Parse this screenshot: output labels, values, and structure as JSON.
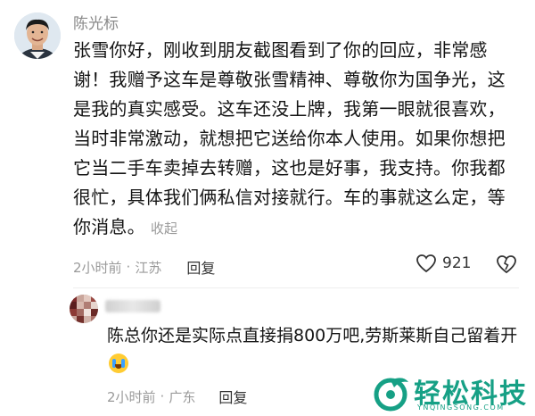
{
  "comment": {
    "author": "陈光标",
    "text": "张雪你好，刚收到朋友截图看到了你的回应，非常感谢！我赠予这车是尊敬张雪精神、尊敬你为国争光，这是我的真实感受。这车还没上牌，我第一眼就很喜欢，当时非常激动，就想把它送给你本人使用。如果你想把它当二手车卖掉去转赠，这也是好事，我支持。你我都很忙，具体我们俩私信对接就行。车的事就这么定，等你消息。",
    "collapse_label": "收起",
    "time": "2小时前",
    "location": "江苏",
    "reply_label": "回复",
    "like_count": "921"
  },
  "reply": {
    "text": "陈总你还是实际点直接捐800万吧,劳斯莱斯自己留着开",
    "time": "2小时前",
    "location": "广东",
    "reply_label": "回复"
  },
  "watermark": {
    "text": "轻松科技",
    "sub": "YNQINGSONG.COM"
  },
  "colors": {
    "meta": "#9a9a9a",
    "watermark": "#16a085"
  }
}
